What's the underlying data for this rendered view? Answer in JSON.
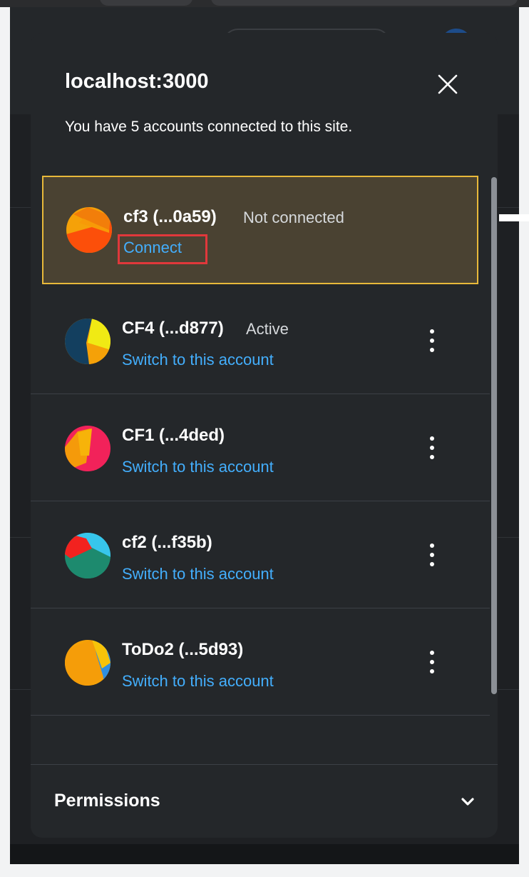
{
  "site": {
    "title": "localhost:3000",
    "subtitle": "You have 5 accounts connected to this site."
  },
  "accounts": [
    {
      "name": "cf3 (...0a59)",
      "status": "Not connected",
      "action": "Connect",
      "icon": "jazzicon-avatar",
      "selected": true
    },
    {
      "name": "CF4 (...d877)",
      "status": "Active",
      "action": "Switch to this account",
      "icon": "jazzicon-avatar"
    },
    {
      "name": "CF1 (...4ded)",
      "status": "",
      "action": "Switch to this account",
      "icon": "jazzicon-avatar"
    },
    {
      "name": "cf2 (...f35b)",
      "status": "",
      "action": "Switch to this account",
      "icon": "jazzicon-avatar"
    },
    {
      "name": "ToDo2 (...5d93)",
      "status": "",
      "action": "Switch to this account",
      "icon": "jazzicon-avatar"
    }
  ],
  "permissions": {
    "label": "Permissions",
    "icon": "chevron-down-icon"
  },
  "icons": {
    "close": "close-icon",
    "more": "kebab-menu-icon"
  },
  "colors": {
    "modal_bg": "#24272a",
    "link": "#43aefc",
    "selected_row_bg": "#4a4232",
    "selected_row_border": "#e8b93a",
    "highlight_box": "#e0383b"
  }
}
